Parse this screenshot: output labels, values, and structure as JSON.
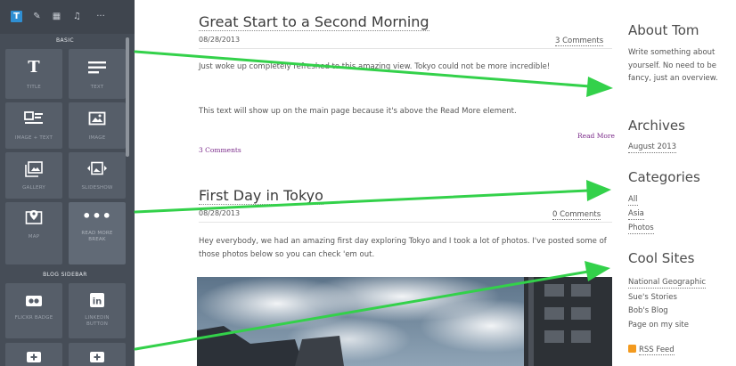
{
  "panel": {
    "tabs": [
      {
        "icon": "text-tab-icon",
        "glyph": "T"
      },
      {
        "icon": "pencil-tab-icon",
        "glyph": "✎"
      },
      {
        "icon": "layout-tab-icon",
        "glyph": "▦"
      },
      {
        "icon": "music-tab-icon",
        "glyph": "♫"
      },
      {
        "icon": "more-tab-icon",
        "glyph": "···"
      }
    ],
    "basic_heading": "BASIC",
    "blog_sidebar_heading": "BLOG SIDEBAR",
    "elements": {
      "title": "TITLE",
      "text": "TEXT",
      "image_text": "IMAGE + TEXT",
      "image": "IMAGE",
      "gallery": "GALLERY",
      "slideshow": "SLIDESHOW",
      "map": "MAP",
      "read_more": "READ MORE BREAK",
      "flickr": "FLICKR BADGE",
      "linkedin": "LINKEDIN BUTTON"
    },
    "colors": {
      "background": "#464d57",
      "tile": "#565e69",
      "active_tab": "#2f8fd3"
    }
  },
  "posts": [
    {
      "title": "Great Start to a Second Morning",
      "date": "08/28/2013",
      "comments": "3 Comments",
      "body": [
        "Just woke up completely refreshed to this amazing view. Tokyo could not be more incredible!",
        "This text will show up on the main page because it's above the Read More element."
      ],
      "read_more": "Read More",
      "footer_comments": "3 Comments"
    },
    {
      "title": "First Day in Tokyo",
      "date": "08/28/2013",
      "comments": "0 Comments",
      "body": [
        "Hey everybody, we had an amazing first day exploring Tokyo and I took a lot of photos. I've posted some of those photos below so you can check 'em out."
      ]
    }
  ],
  "sidebar": {
    "about": {
      "heading": "About Tom",
      "text": "Write something about yourself. No need to be fancy, just an overview."
    },
    "archives": {
      "heading": "Archives",
      "items": [
        "August 2013"
      ]
    },
    "categories": {
      "heading": "Categories",
      "items": [
        "All",
        "Asia",
        "Photos"
      ]
    },
    "cool_sites": {
      "heading": "Cool Sites",
      "items": [
        "National Geographic",
        "Sue's Stories",
        "Bob's Blog",
        "Page on my site"
      ]
    },
    "rss": "RSS Feed"
  },
  "annotation_color": "#33d14a"
}
